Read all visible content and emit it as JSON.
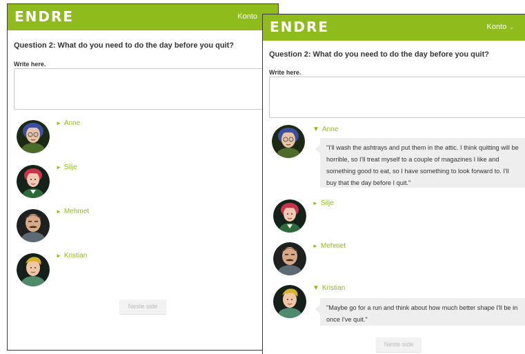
{
  "app": {
    "logo": "ENDRE",
    "account_label": "Konto",
    "account_caret": "⌄",
    "brand_color": "#8fbb1c"
  },
  "page": {
    "question": "Question 2: What do you need to do the day before you quit?",
    "write_label": "Write here.",
    "next_label": "Neste side"
  },
  "icons": {
    "collapsed": "►",
    "expanded": "▼"
  },
  "people": [
    {
      "name": "Anne",
      "avatar": "anne-avatar",
      "hair": "#3b4fa0",
      "skin": "#e9c3a6",
      "shirt": "#4d6b2b"
    },
    {
      "name": "Silje",
      "avatar": "silje-avatar",
      "hair": "#c8354b",
      "skin": "#f1c9b0",
      "shirt": "#2e6b3b"
    },
    {
      "name": "Mehmet",
      "avatar": "mehmet-avatar",
      "hair": "#5b3a2a",
      "skin": "#d6a888",
      "shirt": "#5d6973"
    },
    {
      "name": "Kristian",
      "avatar": "kristian-avatar",
      "hair": "#d9b22b",
      "skin": "#efc6a6",
      "shirt": "#4f8a6c"
    }
  ],
  "quotes": {
    "anne": "\"I'll wash the ashtrays and put them in the attic. I think quitting will be horrible, so I'll treat myself to a couple of magazines I like and something good to eat, so I have something to look forward to. I'll buy that the day before I quit.\"",
    "kristian": "\"Maybe go for a run and think about how much better shape I'll be in once I've quit.\""
  }
}
